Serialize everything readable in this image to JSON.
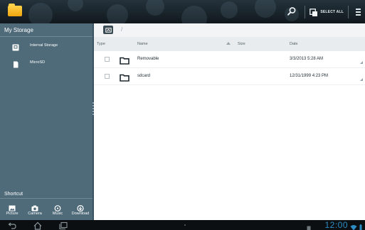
{
  "topbar": {
    "app_icon": "folder-icon",
    "search_icon": "search-icon",
    "select_all_label": "SELECT ALL",
    "menu_icon": "overflow-menu-icon"
  },
  "sidebar": {
    "title": "My Storage",
    "items": [
      {
        "label": "Internal Storage",
        "icon": "internal-storage-icon"
      },
      {
        "label": "MicroSD",
        "icon": "microsd-icon"
      }
    ],
    "shortcut_title": "Shortcut",
    "shortcuts": [
      {
        "label": "Picture",
        "icon": "picture-icon"
      },
      {
        "label": "Camera",
        "icon": "camera-icon"
      },
      {
        "label": "Music",
        "icon": "music-icon"
      },
      {
        "label": "Download",
        "icon": "download-icon"
      }
    ]
  },
  "path": {
    "separator": "/"
  },
  "columns": {
    "type": "Type",
    "name": "Name",
    "size": "Size",
    "date": "Date"
  },
  "files": [
    {
      "name": "Removable",
      "size": "",
      "date": "3/3/2013 5:28 AM"
    },
    {
      "name": "sdcard",
      "size": "",
      "date": "12/31/1999 4:23 PM"
    }
  ],
  "statusbar": {
    "clock": "12:00"
  },
  "colors": {
    "sidebar": "#4f6b7a",
    "topbar": "#1a252c",
    "accent_clock": "#2c8dc4",
    "app_icon": "#f5b21b"
  }
}
